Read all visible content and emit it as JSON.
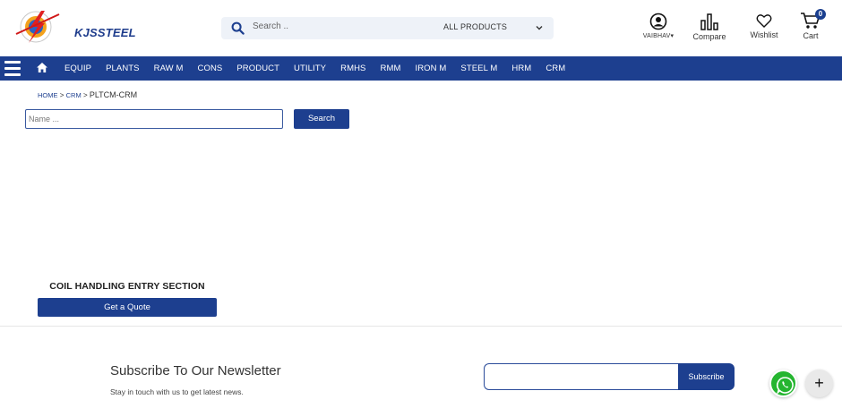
{
  "header": {
    "logo_text": "KJSSTEEL",
    "search": {
      "placeholder": "Search ..",
      "category": "ALL PRODUCTS"
    },
    "user_label": "VAIBHAV",
    "compare_label": "Compare",
    "wishlist_label": "Wishlist",
    "cart_label": "Cart",
    "cart_count": "0"
  },
  "nav": {
    "items": [
      "EQUIP",
      "PLANTS",
      "RAW M",
      "CONS",
      "PRODUCT",
      "UTILITY",
      "RMHS",
      "RMM",
      "IRON M",
      "STEEL M",
      "HRM",
      "CRM"
    ]
  },
  "breadcrumb": {
    "home": "HOME",
    "sep1": " > ",
    "parent": "CRM",
    "sep2": " > ",
    "current": "PLTCM-CRM"
  },
  "filter": {
    "name_placeholder": "Name ...",
    "search_label": "Search"
  },
  "product": {
    "title": "COIL HANDLING ENTRY SECTION",
    "quote_label": "Get a Quote"
  },
  "newsletter": {
    "title": "Subscribe To Our Newsletter",
    "subtitle": "Stay in touch with us to get latest news.",
    "input_value": "",
    "button_label": "Subscribe"
  },
  "floating": {
    "plus_label": "+"
  },
  "colors": {
    "brand_blue": "#1d3f8f",
    "whatsapp_green": "#25b530"
  }
}
